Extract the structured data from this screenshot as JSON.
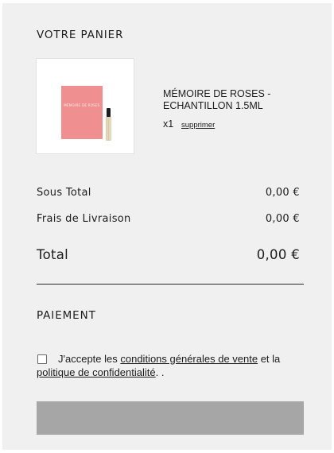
{
  "cart": {
    "title": "VOTRE PANIER",
    "item": {
      "image_card_text": "MÉMOIRE DE ROSES",
      "name": "MÉMOIRE DE ROSES - ECHANTILLON 1.5ML",
      "quantity": "x1",
      "remove_label": "supprimer"
    }
  },
  "summary": {
    "subtotal_label": "Sous Total",
    "subtotal_value": "0,00 €",
    "shipping_label": "Frais de Livraison",
    "shipping_value": "0,00 €",
    "total_label": "Total",
    "total_value": "0,00 €"
  },
  "payment": {
    "title": "PAIEMENT",
    "terms": {
      "prefix": "J'accepte les ",
      "link_conditions": "conditions générales de vente",
      "middle": " et la ",
      "link_privacy": "politique de confidentialité",
      "suffix": ". .",
      "checked": false
    },
    "submit_button_label": ""
  },
  "colors": {
    "panel_background": "#f0f0f0",
    "sample_card": "#f08f90",
    "button_disabled": "#a6a6a6"
  }
}
